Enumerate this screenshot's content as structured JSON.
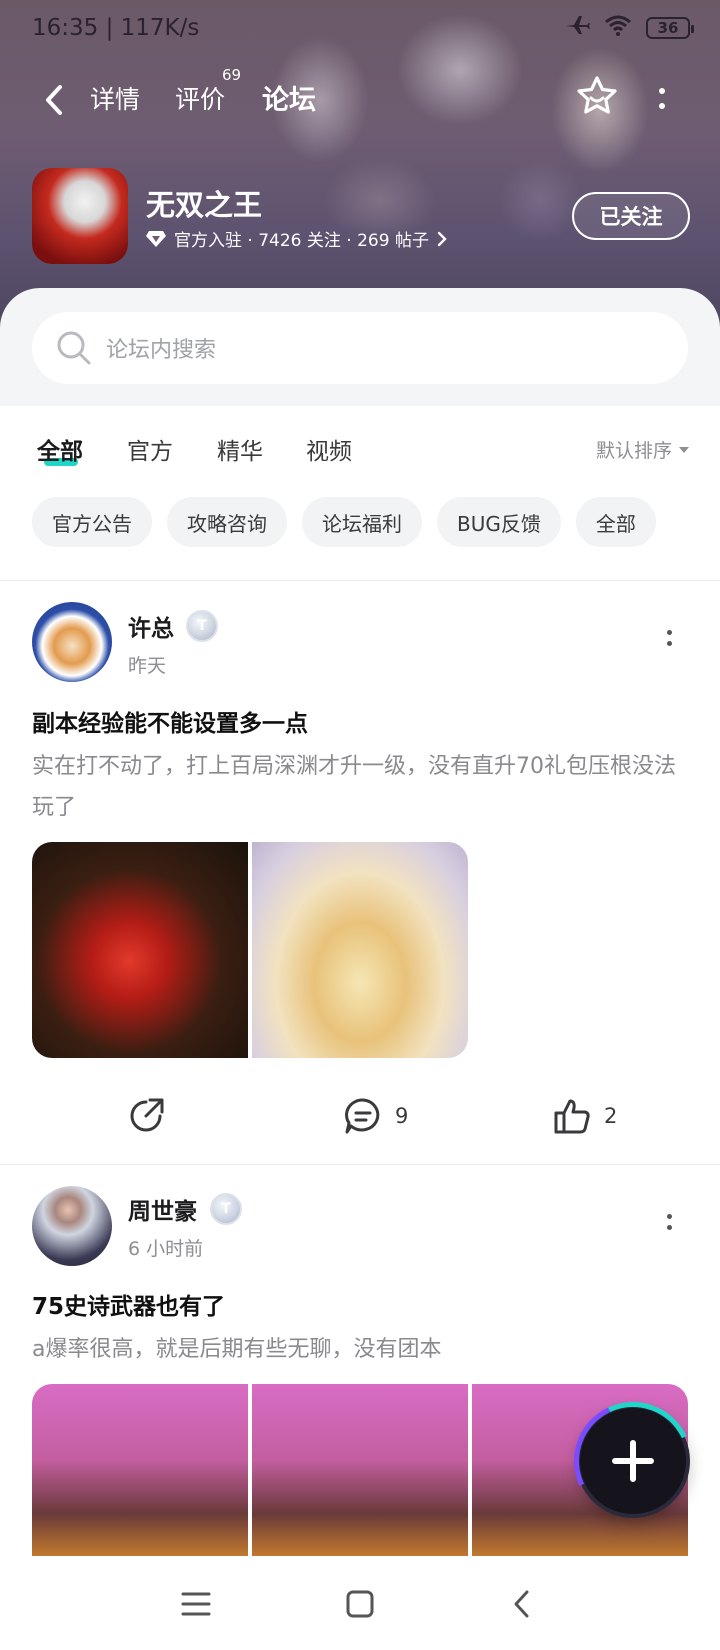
{
  "status_bar": {
    "time_speed": "16:35 | 117K/s",
    "battery": "36"
  },
  "nav": {
    "tabs": [
      {
        "label": "详情"
      },
      {
        "label": "评价",
        "count": "69"
      },
      {
        "label": "论坛"
      }
    ],
    "active_tab": "论坛"
  },
  "game": {
    "name": "无双之王",
    "meta": "官方入驻 · 7426 关注 · 269 帖子",
    "follow_label": "已关注"
  },
  "search": {
    "placeholder": "论坛内搜索"
  },
  "filter_tabs": [
    "全部",
    "官方",
    "精华",
    "视频"
  ],
  "sort_label": "默认排序",
  "chips": [
    "官方公告",
    "攻略咨询",
    "论坛福利",
    "BUG反馈",
    "全部"
  ],
  "posts": [
    {
      "author": "许总",
      "time": "昨天",
      "title": "副本经验能不能设置多一点",
      "body": "实在打不动了，打上百局深渊才升一级，没有直升70礼包压根没法玩了",
      "comments": "9",
      "likes": "2"
    },
    {
      "author": "周世豪",
      "time": "6 小时前",
      "title": "75史诗武器也有了",
      "body": "a爆率很高，就是后期有些无聊，没有团本"
    }
  ],
  "colors": {
    "accent": "#1fd6c8",
    "banner": "#6e5c72"
  }
}
